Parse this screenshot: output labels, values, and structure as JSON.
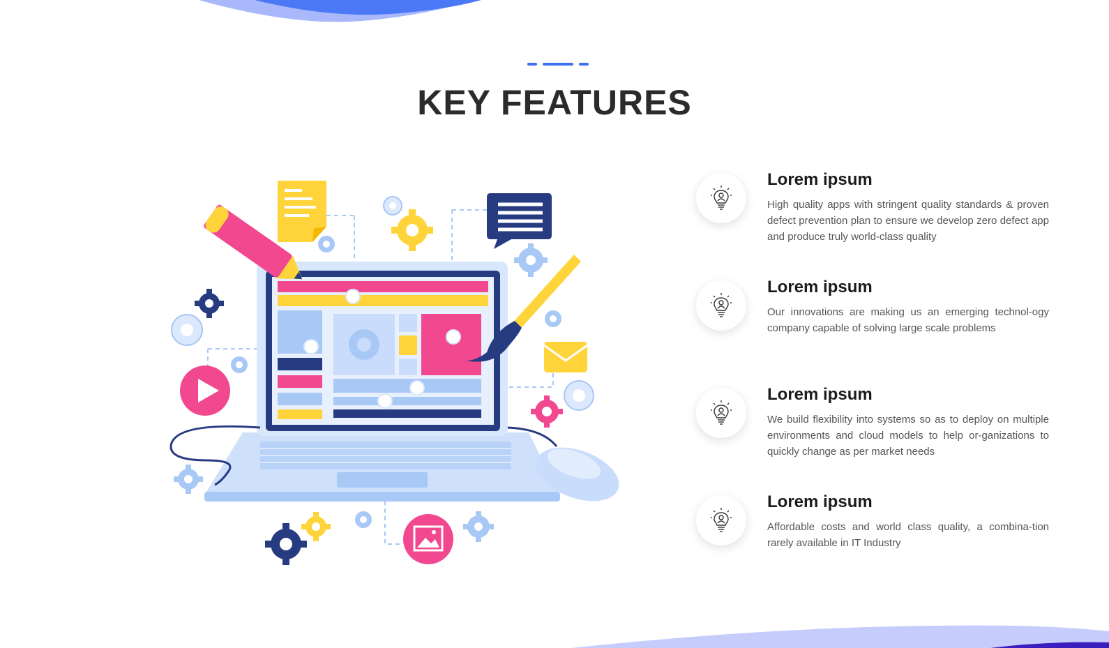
{
  "section": {
    "title": "KEY FEATURES"
  },
  "features": [
    {
      "icon": "lightbulb-person-icon",
      "title": "Lorem ipsum",
      "description": "High quality apps with stringent quality standards & proven defect prevention plan to ensure we develop zero defect app and produce truly world-class quality"
    },
    {
      "icon": "lightbulb-person-icon",
      "title": "Lorem ipsum",
      "description": "Our innovations are making us an emerging technol-ogy company capable of solving large scale problems"
    },
    {
      "icon": "lightbulb-person-icon",
      "title": "Lorem ipsum",
      "description": "We build flexibility into systems so as to deploy on multiple environments and cloud models to help or-ganizations to quickly change as per market needs"
    },
    {
      "icon": "lightbulb-person-icon",
      "title": "Lorem ipsum",
      "description": "Affordable costs and world class quality, a combina-tion rarely available in IT Industry"
    }
  ],
  "colors": {
    "accent_blue": "#3f6ff2",
    "navy": "#273b80",
    "pink": "#f2488f",
    "yellow": "#ffd43b",
    "light_blue": "#a8c8f5",
    "title_text": "#2b2b2b"
  }
}
